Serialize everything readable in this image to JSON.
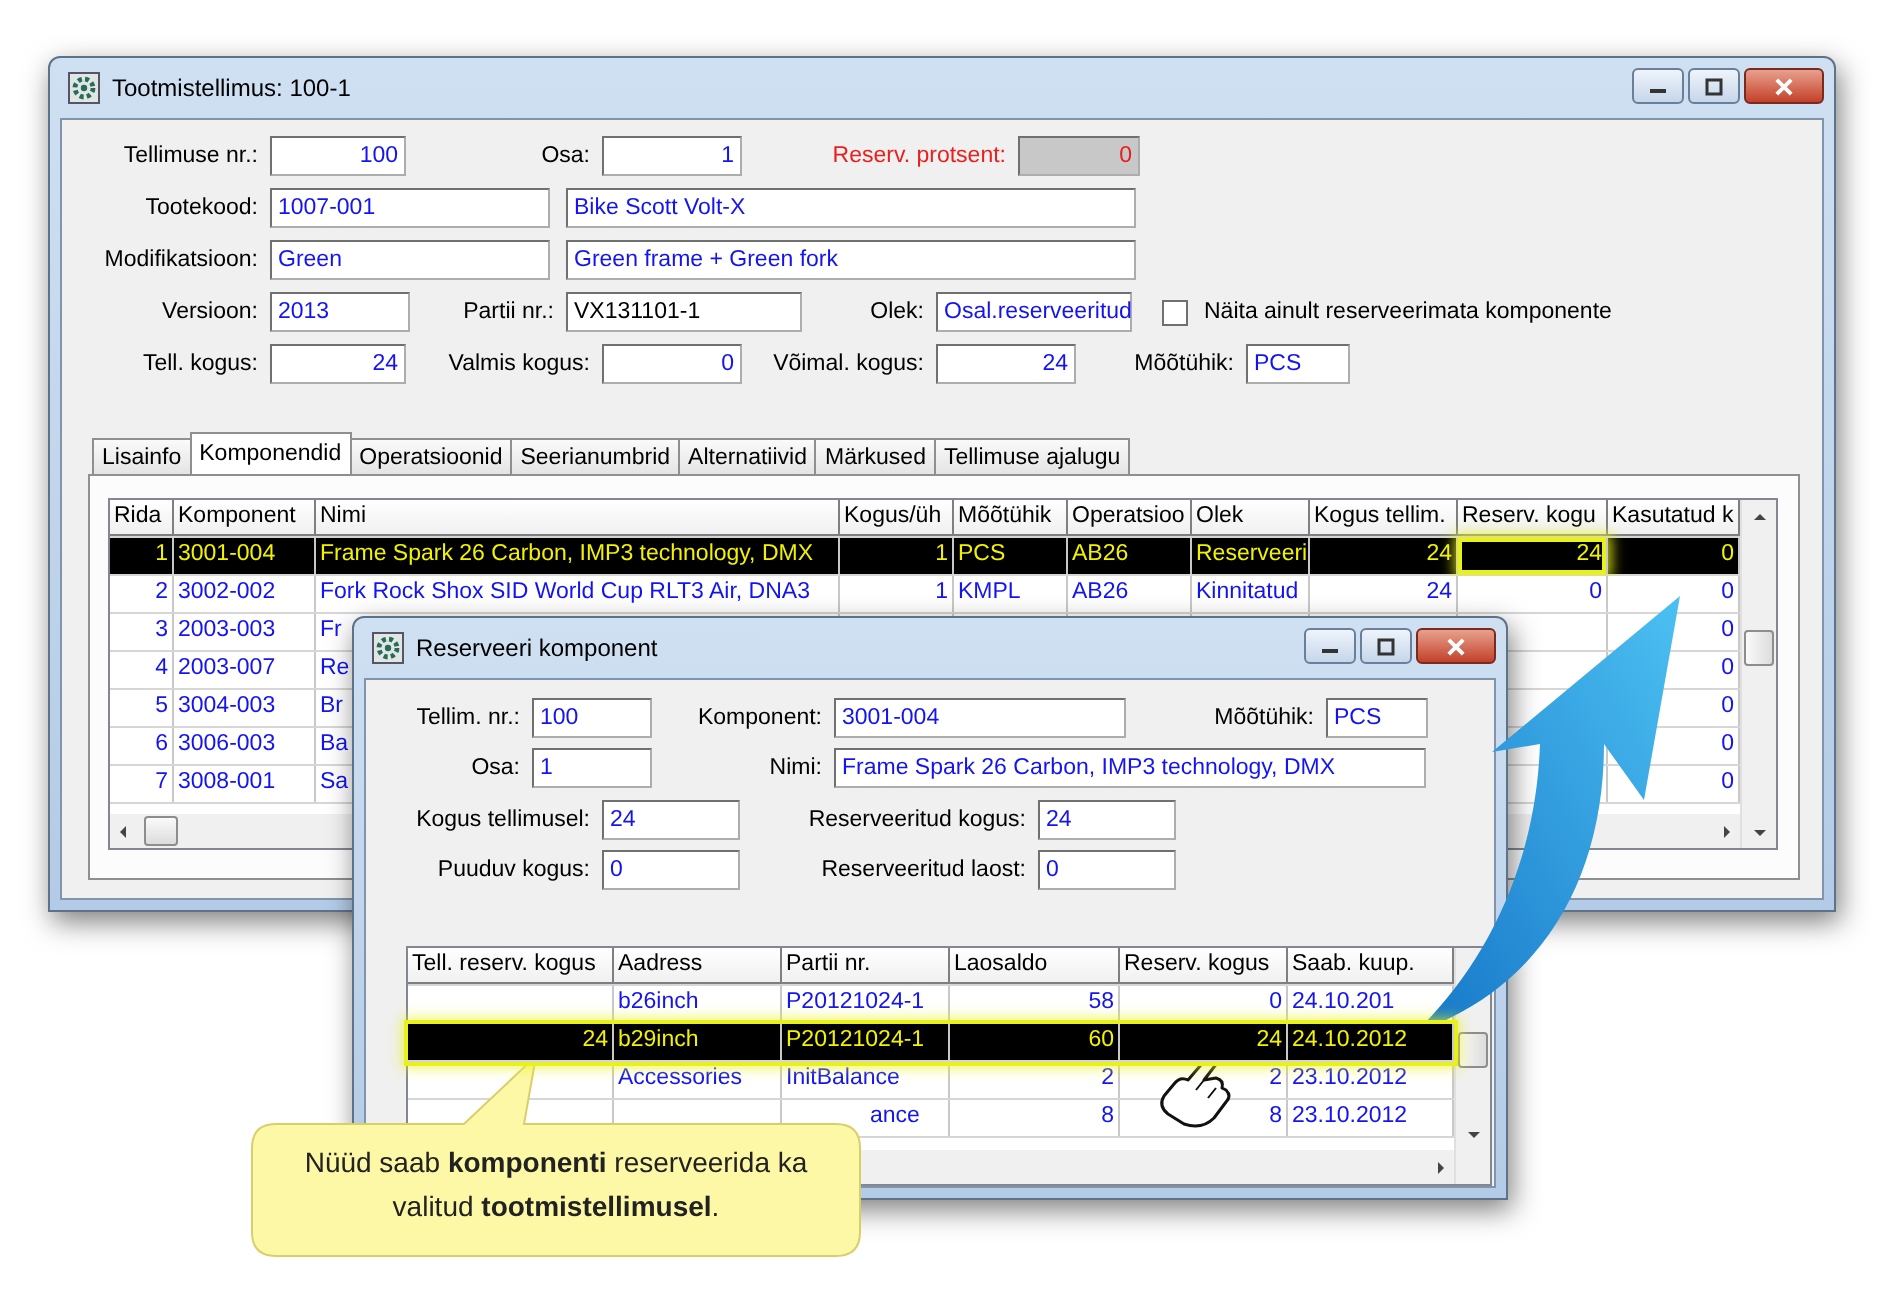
{
  "main_window": {
    "title": "Tootmistellimus: 100-1"
  },
  "order_form": {
    "order_no": {
      "label": "Tellimuse nr.:",
      "value": "100"
    },
    "part": {
      "label": "Osa:",
      "value": "1"
    },
    "reserve_percent": {
      "label": "Reserv. protsent:",
      "value": "0"
    },
    "product_code": {
      "label": "Tootekood:",
      "value": "1007-001",
      "description": "Bike Scott Volt-X"
    },
    "modification": {
      "label": "Modifikatsioon:",
      "value": "Green",
      "description": "Green frame + Green fork"
    },
    "version": {
      "label": "Versioon:",
      "value": "2013"
    },
    "batch_no": {
      "label": "Partii nr.:",
      "value": "VX131101-1"
    },
    "status": {
      "label": "Olek:",
      "value": "Osal.reserveeritud"
    },
    "show_unreserved_only": {
      "label": "Näita ainult reserveerimata komponente",
      "checked": false
    },
    "ordered_qty": {
      "label": "Tell. kogus:",
      "value": "24"
    },
    "finished_qty": {
      "label": "Valmis kogus:",
      "value": "0"
    },
    "possible_qty": {
      "label": "Võimal. kogus:",
      "value": "24"
    },
    "unit": {
      "label": "Mõõtühik:",
      "value": "PCS"
    }
  },
  "tabs": [
    {
      "label": "Lisainfo",
      "selected": false
    },
    {
      "label": "Komponendid",
      "selected": true
    },
    {
      "label": "Operatsioonid",
      "selected": false
    },
    {
      "label": "Seerianumbrid",
      "selected": false
    },
    {
      "label": "Alternatiivid",
      "selected": false
    },
    {
      "label": "Märkused",
      "selected": false
    },
    {
      "label": "Tellimuse ajalugu",
      "selected": false
    }
  ],
  "components_table": {
    "columns": {
      "rida": "Rida",
      "komponent": "Komponent",
      "nimi": "Nimi",
      "kogus_uh": "Kogus/üh",
      "mootuhik": "Mõõtühik",
      "operatsioon": "Operatsioo",
      "olek": "Olek",
      "kogus_tellim": "Kogus tellim.",
      "reserv_kogus": "Reserv. kogu",
      "kasutatud": "Kasutatud k"
    },
    "rows": [
      {
        "selected": true,
        "highlight": true,
        "cells": {
          "rida": "1",
          "komponent": "3001-004",
          "nimi": "Frame Spark 26 Carbon, IMP3 technology, DMX",
          "kogus_uh": "1",
          "mootuhik": "PCS",
          "operatsioon": "AB26",
          "olek": "Reserveeri",
          "kogus_tellim": "24",
          "reserv_kogus": "24",
          "kasutatud": "0"
        }
      },
      {
        "selected": false,
        "highlight": false,
        "cells": {
          "rida": "2",
          "komponent": "3002-002",
          "nimi": "Fork Rock Shox SID World Cup RLT3 Air, DNA3",
          "kogus_uh": "1",
          "mootuhik": "KMPL",
          "operatsioon": "AB26",
          "olek": "Kinnitatud",
          "kogus_tellim": "24",
          "reserv_kogus": "0",
          "kasutatud": "0"
        }
      },
      {
        "selected": false,
        "highlight": false,
        "cells": {
          "rida": "3",
          "komponent": "2003-003",
          "nimi": "Fr",
          "kasutatud": "0"
        }
      },
      {
        "selected": false,
        "highlight": false,
        "cells": {
          "rida": "4",
          "komponent": "2003-007",
          "nimi": "Re",
          "kasutatud": "0"
        }
      },
      {
        "selected": false,
        "highlight": false,
        "cells": {
          "rida": "5",
          "komponent": "3004-003",
          "nimi": "Br",
          "kasutatud": "0"
        }
      },
      {
        "selected": false,
        "highlight": false,
        "cells": {
          "rida": "6",
          "komponent": "3006-003",
          "nimi": "Ba",
          "kasutatud": "0"
        }
      },
      {
        "selected": false,
        "highlight": false,
        "cells": {
          "rida": "7",
          "komponent": "3008-001",
          "nimi": "Sa",
          "kasutatud": "0"
        }
      }
    ]
  },
  "reserve_dialog": {
    "title": "Reserveeri komponent",
    "fields": {
      "order_no": {
        "label": "Tellim. nr.:",
        "value": "100"
      },
      "component": {
        "label": "Komponent:",
        "value": "3001-004"
      },
      "unit": {
        "label": "Mõõtühik:",
        "value": "PCS"
      },
      "part": {
        "label": "Osa:",
        "value": "1"
      },
      "name": {
        "label": "Nimi:",
        "value": "Frame Spark 26 Carbon, IMP3 technology, DMX"
      },
      "order_qty": {
        "label": "Kogus tellimusel:",
        "value": "24"
      },
      "reserved_qty": {
        "label": "Reserveeritud kogus:",
        "value": "24"
      },
      "missing_qty": {
        "label": "Puuduv kogus:",
        "value": "0"
      },
      "reserved_from_stock": {
        "label": "Reserveeritud laost:",
        "value": "0"
      }
    },
    "table": {
      "columns": {
        "tell_reserv": "Tell. reserv. kogus",
        "aadress": "Aadress",
        "partii": "Partii nr.",
        "laosaldo": "Laosaldo",
        "reserv_kogus": "Reserv. kogus",
        "saab_kuup": "Saab. kuup."
      },
      "rows": [
        {
          "selected": false,
          "highlight": false,
          "partii_covered": false,
          "cells": {
            "aadress": "b26inch",
            "partii": "P20121024-1",
            "laosaldo": "58",
            "reserv_kogus": "0",
            "saab_kuup": "24.10.201"
          }
        },
        {
          "selected": true,
          "highlight": true,
          "partii_covered": false,
          "cells": {
            "tell_reserv": "24",
            "aadress": "b29inch",
            "partii": "P20121024-1",
            "laosaldo": "60",
            "reserv_kogus": "24",
            "saab_kuup": "24.10.2012"
          }
        },
        {
          "selected": false,
          "highlight": false,
          "partii_covered": false,
          "cells": {
            "aadress": "Accessories",
            "partii": "InitBalance",
            "laosaldo": "2",
            "reserv_kogus": "2",
            "saab_kuup": "23.10.2012"
          }
        },
        {
          "selected": false,
          "highlight": false,
          "partii_covered": true,
          "cells": {
            "partii": "ance",
            "laosaldo": "8",
            "reserv_kogus": "8",
            "saab_kuup": "23.10.2012"
          }
        }
      ]
    }
  },
  "callout": {
    "text": "Nüüd saab **komponenti** reserveerida ka valitud **tootmistellimusel**."
  }
}
